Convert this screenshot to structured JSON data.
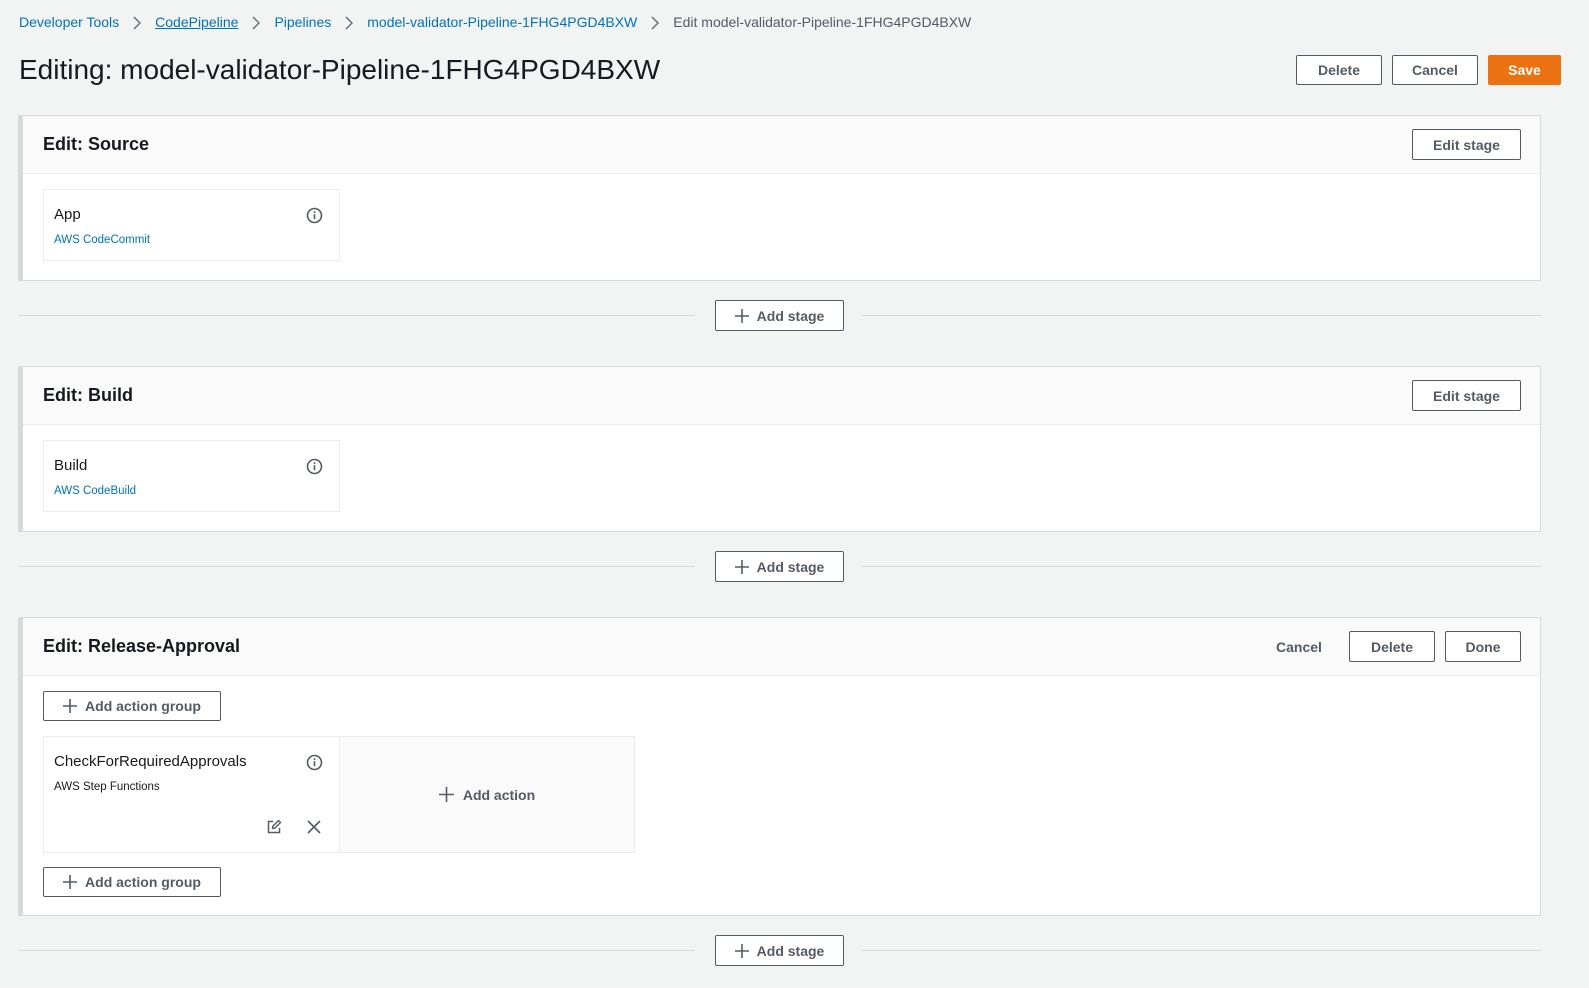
{
  "breadcrumb": {
    "items": [
      "Developer Tools",
      "CodePipeline",
      "Pipelines",
      "model-validator-Pipeline-1FHG4PGD4BXW",
      "Edit model-validator-Pipeline-1FHG4PGD4BXW"
    ]
  },
  "page": {
    "title": "Editing: model-validator-Pipeline-1FHG4PGD4BXW",
    "delete_label": "Delete",
    "cancel_label": "Cancel",
    "save_label": "Save"
  },
  "stages": [
    {
      "title": "Edit: Source",
      "edit_label": "Edit stage",
      "actions": [
        {
          "name": "App",
          "provider": "AWS CodeCommit"
        }
      ]
    },
    {
      "title": "Edit: Build",
      "edit_label": "Edit stage",
      "actions": [
        {
          "name": "Build",
          "provider": "AWS CodeBuild"
        }
      ]
    },
    {
      "title": "Edit: Release-Approval",
      "cancel_label": "Cancel",
      "delete_label": "Delete",
      "done_label": "Done",
      "add_action_group_label": "Add action group",
      "add_action_label": "Add action",
      "actions": [
        {
          "name": "CheckForRequiredApprovals",
          "provider": "AWS Step Functions"
        }
      ]
    }
  ],
  "add_stage_label": "Add stage",
  "colors": {
    "background": "#f2f3f3",
    "link": "#0073bb",
    "primary": "#ec7211",
    "border": "#d5dbdb",
    "text": "#16191f",
    "secondary_text": "#545b64"
  },
  "icons": {
    "breadcrumb_separator": "chevron-right-icon",
    "info": "info-icon",
    "add": "plus-icon",
    "edit": "edit-icon",
    "remove": "close-icon"
  }
}
